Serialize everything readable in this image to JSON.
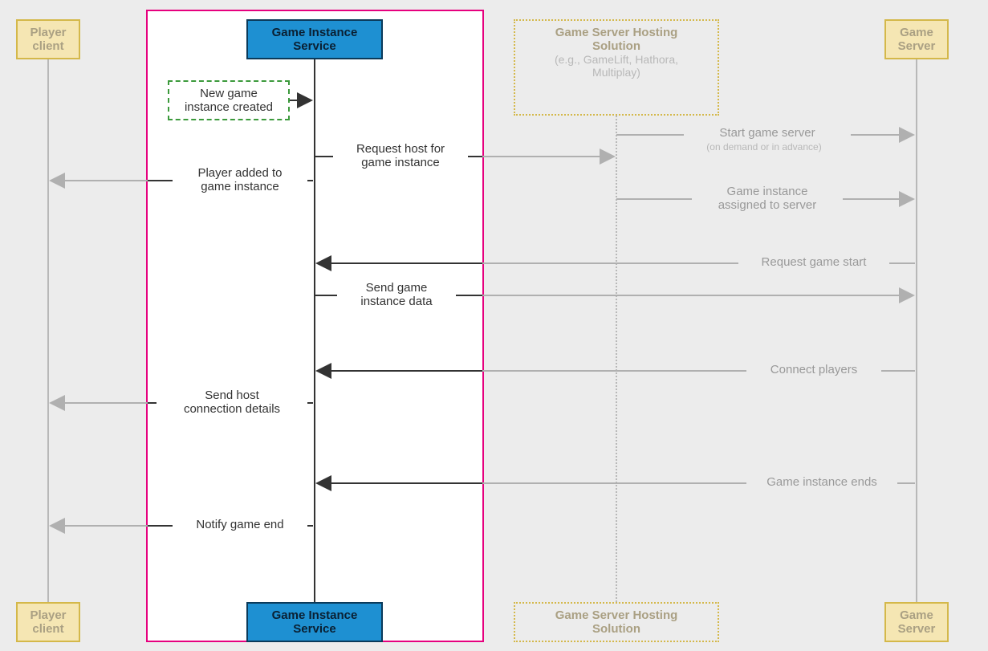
{
  "actors": {
    "player_top": "Player\nclient",
    "player_bottom": "Player\nclient",
    "gis_top": "Game Instance\nService",
    "gis_bottom": "Game Instance\nService",
    "hosting_top_title": "Game Server Hosting\nSolution",
    "hosting_top_sub": "(e.g., GameLift, Hathora,\nMultiplay)",
    "hosting_bottom": "Game Server Hosting\nSolution",
    "server_top": "Game\nServer",
    "server_bottom": "Game\nServer"
  },
  "note": "New game\ninstance created",
  "messages": {
    "start_server": "Start game server",
    "start_server_sub": "(on demand or in advance)",
    "request_host": "Request host for\ngame instance",
    "player_added": "Player added to\ngame instance",
    "assigned": "Game instance\nassigned to server",
    "request_start": "Request game start",
    "send_data": "Send game\ninstance data",
    "connect": "Connect players",
    "send_conn": "Send host\nconnection details",
    "game_ends": "Game instance ends",
    "notify_end": "Notify game end"
  }
}
